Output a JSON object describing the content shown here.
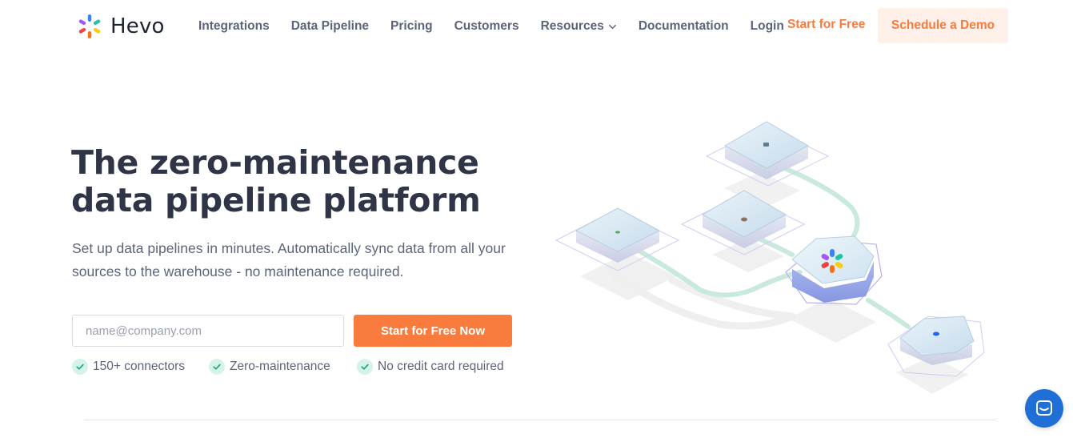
{
  "brand": {
    "name": "Hevo",
    "accent": "#f97b3d",
    "accent_light": "#fff1ea",
    "text_dark": "#2f3546",
    "text_muted": "#5b6478"
  },
  "nav": {
    "items": [
      {
        "label": "Integrations"
      },
      {
        "label": "Data Pipeline"
      },
      {
        "label": "Pricing"
      },
      {
        "label": "Customers"
      },
      {
        "label": "Resources",
        "icon": "chevron-down-icon"
      },
      {
        "label": "Documentation"
      },
      {
        "label": "Login"
      }
    ],
    "start_free": "Start for Free",
    "schedule_demo": "Schedule a Demo"
  },
  "hero": {
    "headline_line1": "The zero-maintenance",
    "headline_line2": "data pipeline platform",
    "subtext": "Set up data pipelines in minutes. Automatically sync data from all your sources to the warehouse - no maintenance required.",
    "email_placeholder": "name@company.com",
    "email_value": "",
    "cta": "Start for Free Now",
    "features": [
      {
        "label": "150+ connectors",
        "icon": "check-icon"
      },
      {
        "label": "Zero-maintenance",
        "icon": "check-icon"
      },
      {
        "label": "No credit card required",
        "icon": "check-icon"
      }
    ]
  },
  "illustration": {
    "hub_icon": "hevo-logo-icon",
    "line_color": "#c9e9dd"
  },
  "chat": {
    "icon": "chat-icon",
    "color": "#1f6fd6"
  }
}
